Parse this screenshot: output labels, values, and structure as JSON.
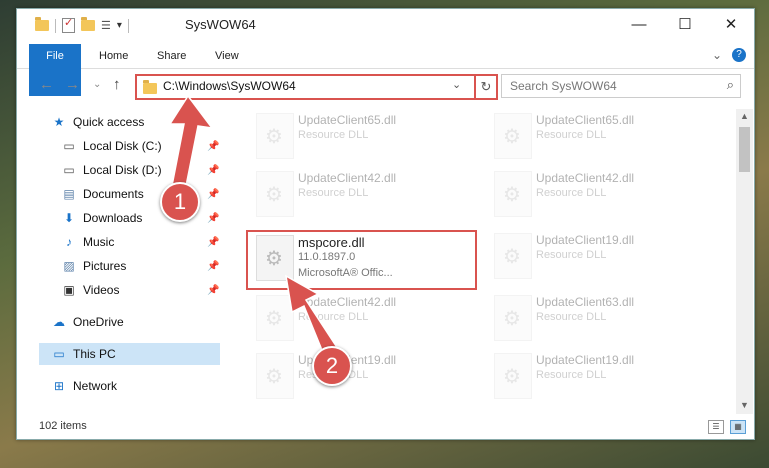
{
  "window": {
    "title": "SysWOW64",
    "controls": {
      "minimize": "—",
      "maximize": "☐",
      "close": "✕"
    }
  },
  "ribbon": {
    "tabs": [
      "File",
      "Home",
      "Share",
      "View"
    ],
    "expand": "⌄",
    "help": "?"
  },
  "nav": {
    "back": "←",
    "forward": "→",
    "recent": "⌄",
    "up": "↑",
    "address": "C:\\Windows\\SysWOW64",
    "address_dropdown": "⌄",
    "refresh": "↻",
    "search_placeholder": "Search SysWOW64",
    "search_icon": "⌕"
  },
  "navpane": {
    "quick_access": "Quick access",
    "items": [
      {
        "label": "Local Disk (C:)",
        "icon": "drive-icon",
        "pinned": true
      },
      {
        "label": "Local Disk (D:)",
        "icon": "drive-icon",
        "pinned": true
      },
      {
        "label": "Documents",
        "icon": "documents-icon",
        "pinned": true
      },
      {
        "label": "Downloads",
        "icon": "downloads-icon",
        "pinned": true
      },
      {
        "label": "Music",
        "icon": "music-icon",
        "pinned": true
      },
      {
        "label": "Pictures",
        "icon": "pictures-icon",
        "pinned": true
      },
      {
        "label": "Videos",
        "icon": "videos-icon",
        "pinned": true
      }
    ],
    "onedrive": "OneDrive",
    "this_pc": "This PC",
    "network": "Network",
    "pin_glyph": "📌"
  },
  "files": {
    "col1": [
      {
        "name": "UpdateClient65.dll",
        "sub": "Resource DLL"
      },
      {
        "name": "UpdateClient42.dll",
        "sub": "Resource DLL"
      },
      {
        "name": "mspcore.dll",
        "sub": "11.0.1897.0",
        "sub2": "MicrosoftA® Offic..."
      },
      {
        "name": "UpdateClient42.dll",
        "sub": "Resource DLL"
      },
      {
        "name": "UpdateClient19.dll",
        "sub": "Resource DLL"
      }
    ],
    "col2": [
      {
        "name": "UpdateClient65.dll",
        "sub": "Resource DLL"
      },
      {
        "name": "UpdateClient42.dll",
        "sub": "Resource DLL"
      },
      {
        "name": "UpdateClient19.dll",
        "sub": "Resource DLL"
      },
      {
        "name": "UpdateClient63.dll",
        "sub": "Resource DLL"
      },
      {
        "name": "UpdateClient19.dll",
        "sub": "Resource DLL"
      }
    ]
  },
  "status": {
    "items_count": "102 items",
    "scroll_up": "▲",
    "scroll_down": "▼",
    "view_details": "☰",
    "view_tiles": "▦"
  },
  "annotations": {
    "callout1": "1",
    "callout2": "2",
    "color": "#d9534f"
  }
}
